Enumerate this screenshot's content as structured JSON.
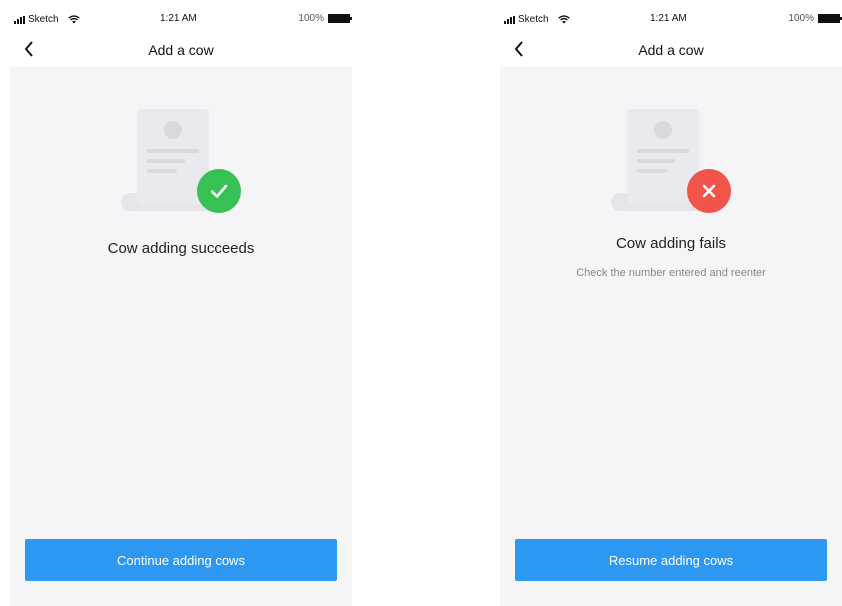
{
  "status_bar": {
    "carrier": "Sketch",
    "time": "1:21 AM",
    "battery": "100%"
  },
  "screens": [
    {
      "nav_title": "Add a cow",
      "result_title": "Cow adding succeeds",
      "status_color": "#37c053",
      "status_icon": "check-icon",
      "button_label": "Continue adding cows"
    },
    {
      "nav_title": "Add a cow",
      "result_title": "Cow adding fails",
      "result_subtitle": "Check the number entered and reenter",
      "status_color": "#f0544a",
      "status_icon": "close-icon",
      "button_label": "Resume adding cows"
    }
  ],
  "colors": {
    "accent": "#2d98f2",
    "background": "#f5f5f7"
  }
}
